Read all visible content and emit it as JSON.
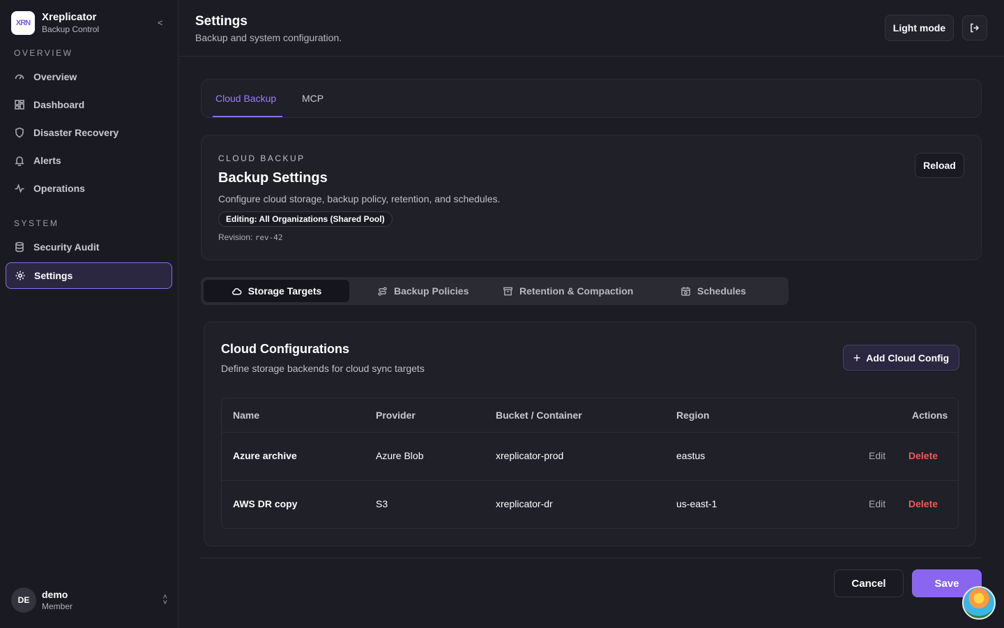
{
  "brand": {
    "name": "Xreplicator",
    "subtitle": "Backup Control",
    "logo_text": "XRN",
    "collapse": "<"
  },
  "sidebar": {
    "section_overview": "OVERVIEW",
    "section_system": "SYSTEM",
    "items": [
      {
        "label": "Overview",
        "icon": "gauge-icon"
      },
      {
        "label": "Dashboard",
        "icon": "grid-icon"
      },
      {
        "label": "Disaster Recovery",
        "icon": "shield-icon"
      },
      {
        "label": "Alerts",
        "icon": "bell-icon"
      },
      {
        "label": "Operations",
        "icon": "activity-icon"
      },
      {
        "label": "Security Audit",
        "icon": "database-icon"
      },
      {
        "label": "Settings",
        "icon": "gear-icon",
        "active": true
      }
    ]
  },
  "user": {
    "initials": "DE",
    "name": "demo",
    "role": "Member"
  },
  "header": {
    "title": "Settings",
    "subtitle": "Backup and system configuration.",
    "light_mode": "Light mode"
  },
  "tabs": [
    {
      "label": "Cloud Backup",
      "active": true
    },
    {
      "label": "MCP"
    }
  ],
  "backup": {
    "eyebrow": "CLOUD BACKUP",
    "title": "Backup Settings",
    "description": "Configure cloud storage, backup policy, retention, and schedules.",
    "editing_badge": "Editing: All Organizations (Shared Pool)",
    "revision_label": "Revision:",
    "revision_value": "rev-42",
    "reload": "Reload"
  },
  "subtabs": [
    {
      "label": "Storage Targets",
      "icon": "cloud-icon",
      "active": true
    },
    {
      "label": "Backup Policies",
      "icon": "route-icon"
    },
    {
      "label": "Retention & Compaction",
      "icon": "archive-icon"
    },
    {
      "label": "Schedules",
      "icon": "calendar-clock-icon"
    }
  ],
  "cloud": {
    "title": "Cloud Configurations",
    "description": "Define storage backends for cloud sync targets",
    "add_button": "Add Cloud Config",
    "columns": [
      "Name",
      "Provider",
      "Bucket / Container",
      "Region",
      "Actions"
    ],
    "rows": [
      {
        "name": "Azure archive",
        "provider": "Azure Blob",
        "bucket": "xreplicator-prod",
        "region": "eastus",
        "edit": "Edit",
        "delete": "Delete"
      },
      {
        "name": "AWS DR copy",
        "provider": "S3",
        "bucket": "xreplicator-dr",
        "region": "us-east-1",
        "edit": "Edit",
        "delete": "Delete"
      }
    ]
  },
  "footer": {
    "cancel": "Cancel",
    "save": "Save"
  },
  "colors": {
    "accent": "#8a66f0",
    "danger": "#ef5b5b",
    "background": "#1c1d24"
  }
}
